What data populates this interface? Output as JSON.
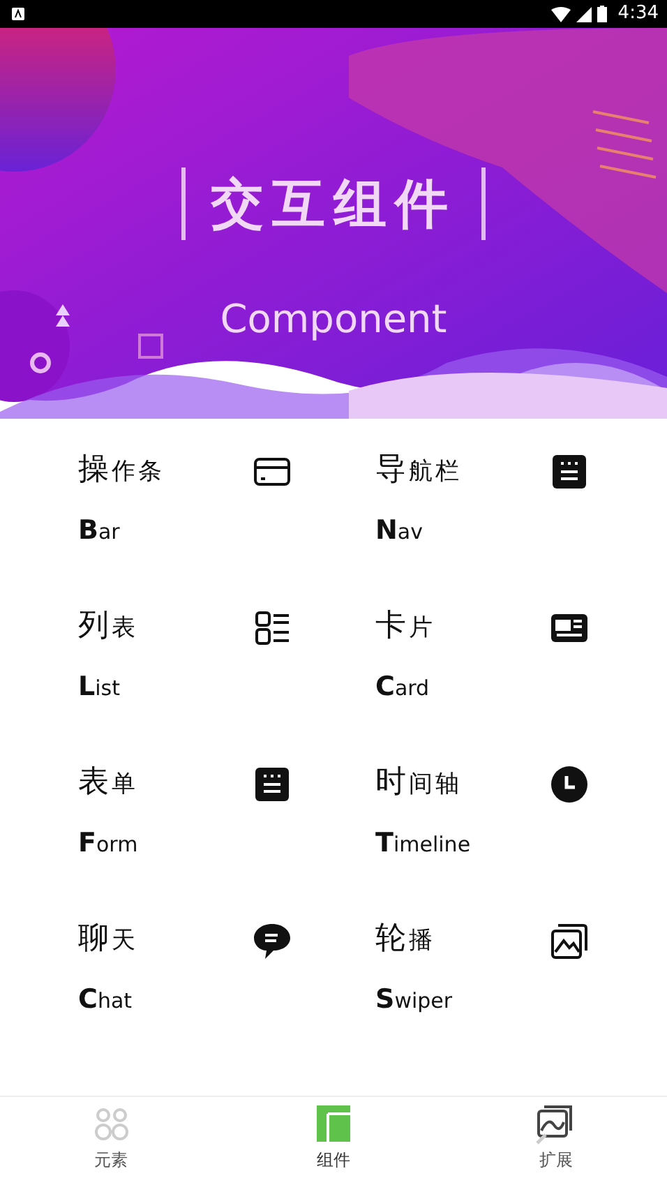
{
  "status_bar": {
    "time": "4:34"
  },
  "banner": {
    "kind": "picture",
    "title": "交互组件",
    "subtitle": "Component"
  },
  "components": [
    {
      "title": "操作条",
      "name": "**B**ar"
    },
    {
      "title": "导航栏",
      "name": "**N**av"
    },
    {
      "title": "列表",
      "name": "**L**ist"
    },
    {
      "title": "卡片",
      "name": "**C**ard"
    },
    {
      "title": "表单",
      "name": "**F**orm"
    },
    {
      "title": "时间轴",
      "name": "**T**imeline"
    },
    {
      "title": "聊天",
      "name": "**C**hat"
    },
    {
      "title": "轮播",
      "name": "**S**wiper"
    }
  ],
  "tab_bar": [
    {
      "label": "元素",
      "selected": false
    },
    {
      "label": "组件",
      "selected": true
    },
    {
      "label": "扩展",
      "selected": false
    }
  ]
}
